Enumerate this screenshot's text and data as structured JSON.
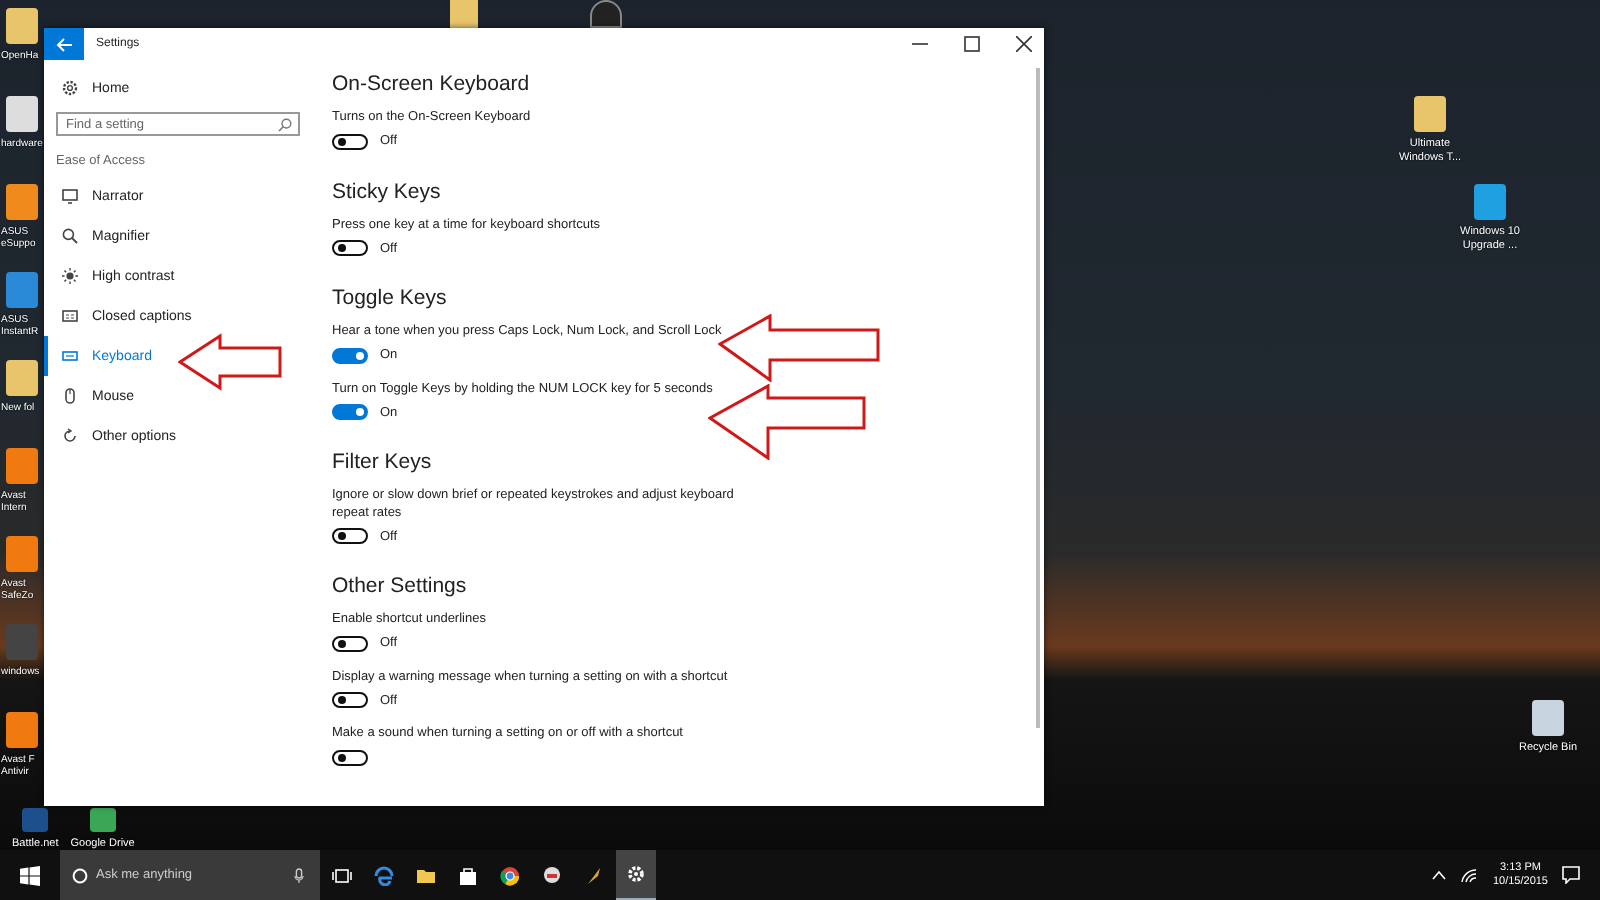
{
  "desktop": {
    "icons_left": [
      {
        "label": "OpenHa"
      },
      {
        "label": "hardware"
      },
      {
        "label": "ASUS eSuppo"
      },
      {
        "label": "ASUS InstantR"
      },
      {
        "label": "New fol"
      },
      {
        "label": "Avast Intern"
      },
      {
        "label": "Avast SafeZo"
      },
      {
        "label": "windows"
      },
      {
        "label": "Avast F Antivir"
      }
    ],
    "icons_bottom": [
      {
        "label": "Battle.net"
      },
      {
        "label": "Google Drive"
      }
    ],
    "icons_right": [
      {
        "label": "Ultimate Windows T..."
      },
      {
        "label": "Windows 10 Upgrade ..."
      },
      {
        "label": "Recycle Bin"
      }
    ]
  },
  "window": {
    "title": "Settings"
  },
  "sidebar": {
    "home": "Home",
    "search": {
      "placeholder": "Find a setting"
    },
    "section": "Ease of Access",
    "items": [
      {
        "label": "Narrator",
        "selected": false
      },
      {
        "label": "Magnifier",
        "selected": false
      },
      {
        "label": "High contrast",
        "selected": false
      },
      {
        "label": "Closed captions",
        "selected": false
      },
      {
        "label": "Keyboard",
        "selected": true
      },
      {
        "label": "Mouse",
        "selected": false
      },
      {
        "label": "Other options",
        "selected": false
      }
    ]
  },
  "sections": [
    {
      "title": "On-Screen Keyboard",
      "settings": [
        {
          "description": "Turns on the On-Screen Keyboard",
          "on": false,
          "state_label": "Off"
        }
      ]
    },
    {
      "title": "Sticky Keys",
      "settings": [
        {
          "description": "Press one key at a time for keyboard shortcuts",
          "on": false,
          "state_label": "Off"
        }
      ]
    },
    {
      "title": "Toggle Keys",
      "settings": [
        {
          "description": "Hear a tone when you press Caps Lock, Num Lock, and Scroll Lock",
          "on": true,
          "state_label": "On"
        },
        {
          "description": "Turn on Toggle Keys by holding the NUM LOCK key for 5 seconds",
          "on": true,
          "state_label": "On"
        }
      ]
    },
    {
      "title": "Filter Keys",
      "settings": [
        {
          "description": "Ignore or slow down brief or repeated keystrokes and adjust keyboard repeat rates",
          "on": false,
          "state_label": "Off"
        }
      ]
    },
    {
      "title": "Other Settings",
      "settings": [
        {
          "description": "Enable shortcut underlines",
          "on": false,
          "state_label": "Off"
        },
        {
          "description": "Display a warning message when turning a setting on with a shortcut",
          "on": false,
          "state_label": "Off"
        },
        {
          "description": "Make a sound when turning a setting on or off with a shortcut",
          "on": false
        }
      ]
    }
  ],
  "taskbar": {
    "search": {
      "placeholder": "Ask me anything"
    },
    "apps": [
      {
        "active": false
      },
      {
        "active": false
      },
      {
        "active": false
      },
      {
        "active": false
      },
      {
        "active": false
      },
      {
        "active": false
      },
      {
        "active": true
      }
    ],
    "clock": {
      "time": "3:13 PM",
      "date": "10/15/2015"
    }
  }
}
